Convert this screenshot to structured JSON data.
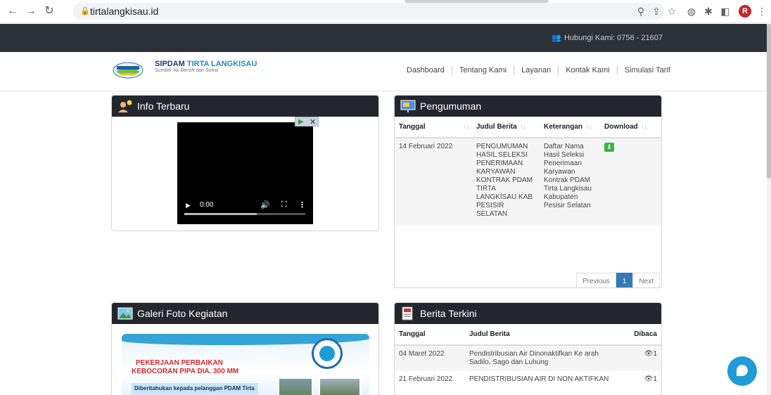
{
  "browser": {
    "url": "tirtalangkisau.id"
  },
  "topbar": {
    "contact": "Hubungi Kami: 0756 - 21607"
  },
  "header": {
    "brand_name": "SIPDAM",
    "brand_accent": "TIRTA LANGKISAU",
    "tagline": "Sumber Air Bersih dan Sehat",
    "nav": [
      "Dashboard",
      "Tentang Kami",
      "Layanan",
      "Kontak Kami",
      "Simulasi Tarif"
    ]
  },
  "info_panel": {
    "title": "Info Terbaru",
    "video": {
      "time": "0:00"
    }
  },
  "pengumuman": {
    "title": "Pengumuman",
    "columns": [
      "Tanggal",
      "Judul Berita",
      "Keterangan",
      "Download"
    ],
    "rows": [
      {
        "tanggal": "14 Februari 2022",
        "judul": "PENGUMUMAN HASIL SELEKSI PENERIMAAN KARYAWAN KONTRAK PDAM TIRTA LANGKISAU KAB PESISIR SELATAN",
        "keterangan": "Daftar Nama Hasil Seleksi Penerimaan Karyawan Kontrak PDAM Tirta Langkisau Kabupaten Pesisir Selatan"
      }
    ],
    "pagination": {
      "previous": "Previous",
      "current": "1",
      "next": "Next"
    }
  },
  "galeri": {
    "title": "Galeri Foto Kegiatan",
    "headline1": "PEKERJAAN PERBAIKAN",
    "headline2": "KEBOCORAN PIPA DIA. 300 MM",
    "subline": "Diberitahukan kepada pelanggan PDAM Tirta"
  },
  "berita": {
    "title": "Berita Terkini",
    "columns": [
      "Tanggal",
      "Judul Berita",
      "Dibaca"
    ],
    "rows": [
      {
        "tanggal": "04 Maret 2022",
        "judul": "Pendistribusian Air Dinonaktifkan Ke arah Sadilo, Sago dan Luhung",
        "dibaca": "1"
      },
      {
        "tanggal": "21 Februari 2022",
        "judul": "PENDISTRIBUSIAN AIR DI NON AKTIFKAN",
        "dibaca": "1"
      }
    ]
  },
  "colors": {
    "topbar": "#2c3138",
    "panel_header": "#23272d",
    "accent_blue": "#337ab7",
    "download_green": "#3cb44b",
    "chat_button": "#1f9bd6"
  }
}
